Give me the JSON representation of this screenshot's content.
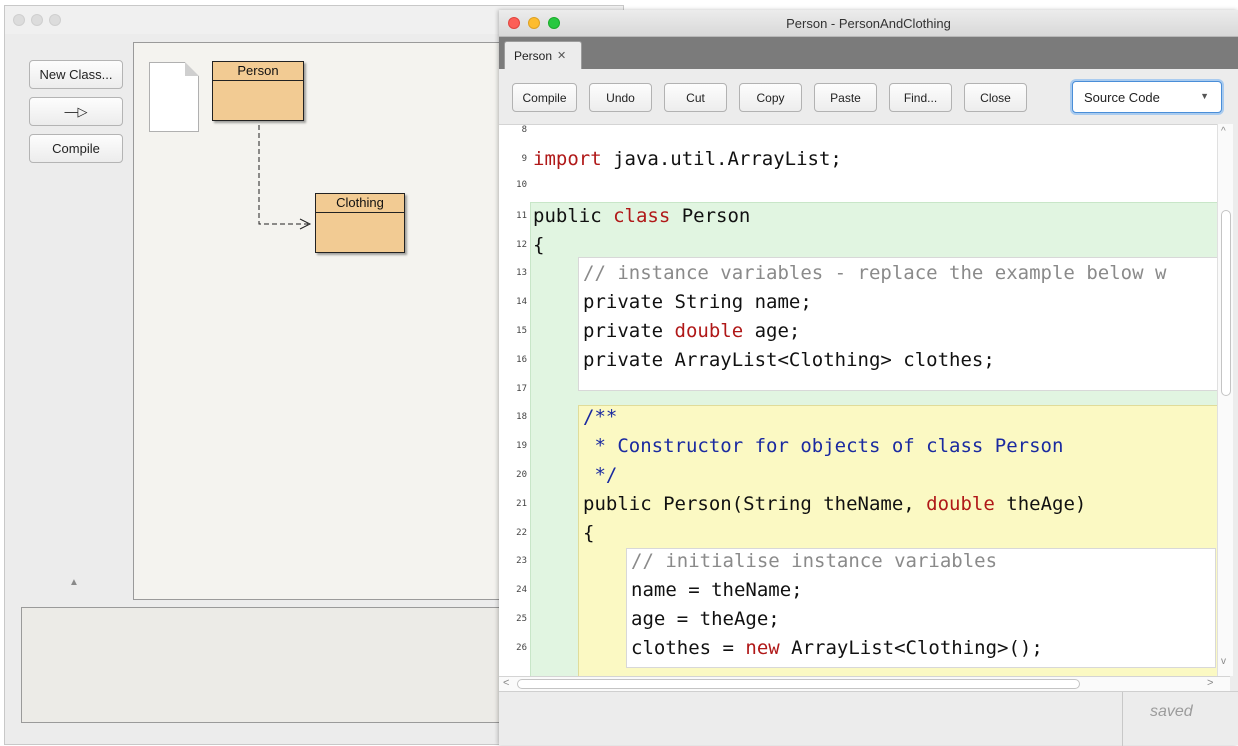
{
  "main": {
    "buttons": {
      "new_class": "New Class...",
      "arrow": "—▷",
      "compile": "Compile"
    },
    "classes": [
      {
        "name": "Person"
      },
      {
        "name": "Clothing"
      }
    ]
  },
  "editor": {
    "title": "Person - PersonAndClothing",
    "tab": {
      "label": "Person",
      "close": "✕"
    },
    "toolbar": {
      "compile": "Compile",
      "undo": "Undo",
      "cut": "Cut",
      "copy": "Copy",
      "paste": "Paste",
      "find": "Find...",
      "close": "Close"
    },
    "view_select": {
      "value": "Source Code"
    },
    "line_numbers": [
      "8",
      "9",
      "10",
      "11",
      "12",
      "13",
      "14",
      "15",
      "16",
      "17",
      "18",
      "19",
      "20",
      "21",
      "22",
      "23",
      "24",
      "25",
      "26"
    ],
    "status": "saved"
  },
  "colors": {
    "class_fill": "#f2cb93",
    "keyword": "#b01818",
    "comment": "#8a8a8a",
    "javadoc": "#1a2aa0",
    "scope_class": "#e1f5e1",
    "scope_method": "#fbf9c3"
  }
}
